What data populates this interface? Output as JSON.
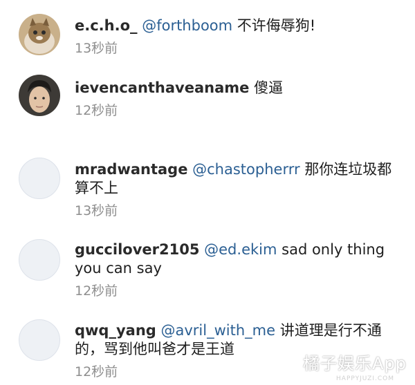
{
  "comments": [
    {
      "username": "e.c.h.o_",
      "mention": "@forthboom",
      "text": "不许侮辱狗!",
      "time": "13秒前",
      "avatar": "cat-avatar"
    },
    {
      "username": "ievencanthaveaname",
      "mention": "",
      "text": "傻逼",
      "time": "12秒前",
      "avatar": "person-avatar"
    },
    {
      "username": "mradwantage",
      "mention": "@chastopherrr",
      "text": "那你连垃圾都算不上",
      "time": "13秒前",
      "avatar": "placeholder"
    },
    {
      "username": "guccilover2105",
      "mention": "@ed.ekim",
      "text": "sad only thing you can say",
      "time": "12秒前",
      "avatar": "placeholder"
    },
    {
      "username": "qwq_yang",
      "mention": "@avril_with_me",
      "text": "讲道理是行不通的，骂到他叫爸才是王道",
      "time": "12秒前",
      "avatar": "placeholder"
    }
  ],
  "watermark": "橘子娱乐App",
  "watermark_sub": "HAPPYJUZI.COM"
}
